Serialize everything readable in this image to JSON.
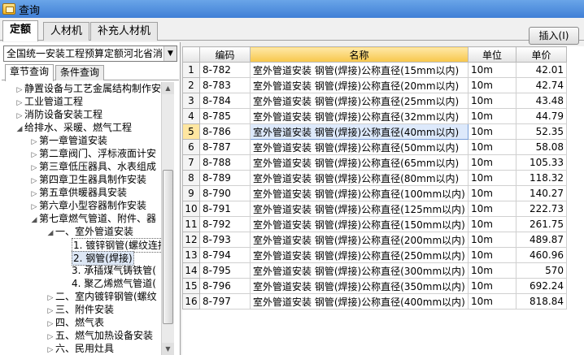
{
  "window": {
    "title": "查询"
  },
  "tabs": [
    "定额",
    "人材机",
    "补充人材机"
  ],
  "insert_button": "插入(I)",
  "region_select": "全国统一安装工程预算定额河北省消",
  "subtabs": [
    "章节查询",
    "条件查询"
  ],
  "tree": [
    {
      "label": "静置设备与工艺金属结构制作安",
      "level": 1,
      "expander": "▷"
    },
    {
      "label": "工业管道工程",
      "level": 1,
      "expander": "▷"
    },
    {
      "label": "消防设备安装工程",
      "level": 1,
      "expander": "▷"
    },
    {
      "label": "给排水、采暖、燃气工程",
      "level": 1,
      "expander": "◢"
    },
    {
      "label": "第一章管道安装",
      "level": 2,
      "expander": "▷"
    },
    {
      "label": "第二章阀门、浮标液面计安",
      "level": 2,
      "expander": "▷"
    },
    {
      "label": "第三章低压器具、水表组成",
      "level": 2,
      "expander": "▷"
    },
    {
      "label": "第四章卫生器具制作安装",
      "level": 2,
      "expander": "▷"
    },
    {
      "label": "第五章供暖器具安装",
      "level": 2,
      "expander": "▷"
    },
    {
      "label": "第六章小型容器制作安装",
      "level": 2,
      "expander": "▷"
    },
    {
      "label": "第七章燃气管道、附件、器",
      "level": 2,
      "expander": "◢"
    },
    {
      "label": "一、室外管道安装",
      "level": 3,
      "expander": "◢"
    },
    {
      "label": "1. 镀锌钢管(螺纹连接",
      "level": 4,
      "expander": "",
      "state": "sel"
    },
    {
      "label": "2. 钢管(焊接)",
      "level": 4,
      "expander": "",
      "state": "focus"
    },
    {
      "label": "3. 承插煤气铸铁管(",
      "level": 4,
      "expander": ""
    },
    {
      "label": "4. 聚乙烯燃气管道(",
      "level": 4,
      "expander": ""
    },
    {
      "label": "二、室内镀锌钢管(螺纹",
      "level": 3,
      "expander": "▷"
    },
    {
      "label": "三、附件安装",
      "level": 3,
      "expander": "▷"
    },
    {
      "label": "四、燃气表",
      "level": 3,
      "expander": "▷"
    },
    {
      "label": "五、燃气加热设备安装",
      "level": 3,
      "expander": "▷"
    },
    {
      "label": "六、民用灶具",
      "level": 3,
      "expander": "▷"
    }
  ],
  "table": {
    "columns": [
      "编码",
      "名称",
      "单位",
      "单价"
    ],
    "rows": [
      {
        "n": "1",
        "code": "8-782",
        "name": "室外管道安装 钢管(焊接)公称直径(15mm以内)",
        "unit": "10m",
        "price": "42.01"
      },
      {
        "n": "2",
        "code": "8-783",
        "name": "室外管道安装 钢管(焊接)公称直径(20mm以内)",
        "unit": "10m",
        "price": "42.74"
      },
      {
        "n": "3",
        "code": "8-784",
        "name": "室外管道安装 钢管(焊接)公称直径(25mm以内)",
        "unit": "10m",
        "price": "43.48"
      },
      {
        "n": "4",
        "code": "8-785",
        "name": "室外管道安装 钢管(焊接)公称直径(32mm以内)",
        "unit": "10m",
        "price": "44.79"
      },
      {
        "n": "5",
        "code": "8-786",
        "name": "室外管道安装 钢管(焊接)公称直径(40mm以内)",
        "unit": "10m",
        "price": "52.35"
      },
      {
        "n": "6",
        "code": "8-787",
        "name": "室外管道安装 钢管(焊接)公称直径(50mm以内)",
        "unit": "10m",
        "price": "58.08"
      },
      {
        "n": "7",
        "code": "8-788",
        "name": "室外管道安装 钢管(焊接)公称直径(65mm以内)",
        "unit": "10m",
        "price": "105.33"
      },
      {
        "n": "8",
        "code": "8-789",
        "name": "室外管道安装 钢管(焊接)公称直径(80mm以内)",
        "unit": "10m",
        "price": "118.32"
      },
      {
        "n": "9",
        "code": "8-790",
        "name": "室外管道安装 钢管(焊接)公称直径(100mm以内)",
        "unit": "10m",
        "price": "140.27"
      },
      {
        "n": "10",
        "code": "8-791",
        "name": "室外管道安装 钢管(焊接)公称直径(125mm以内)",
        "unit": "10m",
        "price": "222.73"
      },
      {
        "n": "11",
        "code": "8-792",
        "name": "室外管道安装 钢管(焊接)公称直径(150mm以内)",
        "unit": "10m",
        "price": "261.75"
      },
      {
        "n": "12",
        "code": "8-793",
        "name": "室外管道安装 钢管(焊接)公称直径(200mm以内)",
        "unit": "10m",
        "price": "489.87"
      },
      {
        "n": "13",
        "code": "8-794",
        "name": "室外管道安装 钢管(焊接)公称直径(250mm以内)",
        "unit": "10m",
        "price": "460.96"
      },
      {
        "n": "14",
        "code": "8-795",
        "name": "室外管道安装 钢管(焊接)公称直径(300mm以内)",
        "unit": "10m",
        "price": "570"
      },
      {
        "n": "15",
        "code": "8-796",
        "name": "室外管道安装 钢管(焊接)公称直径(350mm以内)",
        "unit": "10m",
        "price": "692.24"
      },
      {
        "n": "16",
        "code": "8-797",
        "name": "室外管道安装 钢管(焊接)公称直径(400mm以内)",
        "unit": "10m",
        "price": "818.84"
      }
    ]
  }
}
